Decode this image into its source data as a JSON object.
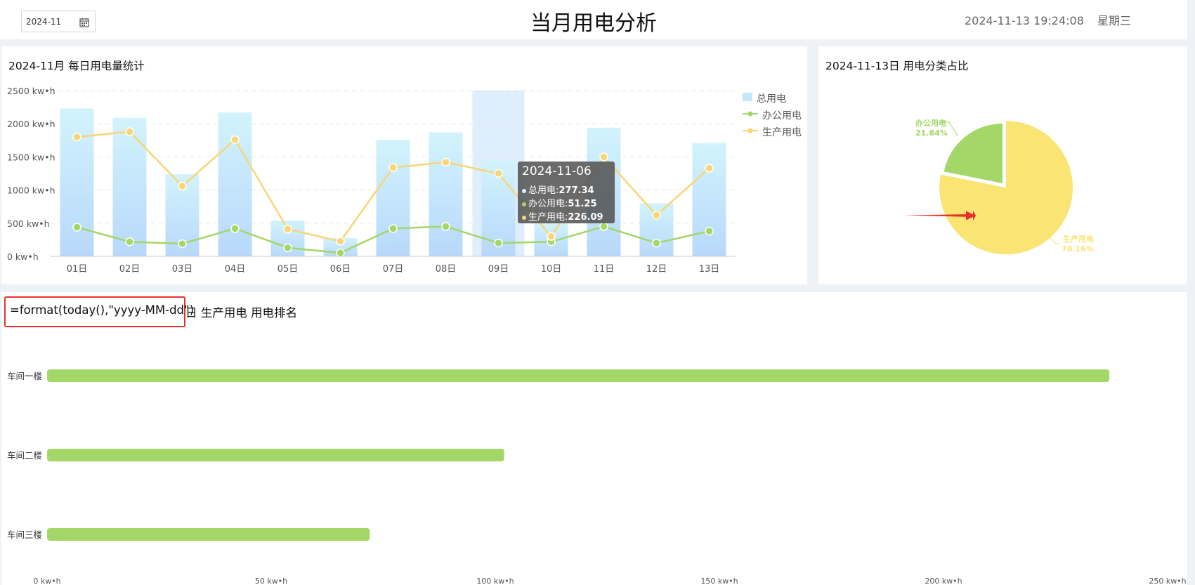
{
  "header": {
    "month_value": "2024-11",
    "title": "当月用电分析",
    "datetime": "2024-11-13 19:24:08",
    "weekday": "星期三"
  },
  "daily_panel": {
    "title": "2024-11月 每日用电量统计",
    "legend": [
      "总用电",
      "办公用电",
      "生产用电"
    ]
  },
  "tooltip": {
    "date": "2024-11-06",
    "rows": [
      {
        "label": "总用电:",
        "value": "277.34"
      },
      {
        "label": "办公用电:",
        "value": "51.25"
      },
      {
        "label": "生产用电:",
        "value": "226.09"
      }
    ]
  },
  "pie_panel": {
    "title": "2024-11-13日 用电分类占比"
  },
  "rank_panel": {
    "formula": "=format(today(),\"yyyy-MM-dd\")",
    "title_suffix": "日 生产用电 用电排名"
  },
  "colors": {
    "total_bar_top": "#d2f3fc",
    "total_bar_bottom": "#b8d8fb",
    "office": "#a3d768",
    "production": "#f8d677",
    "pie_production": "#fae574",
    "pie_office": "#a3d768",
    "highlight": "#e8302a"
  },
  "chart_data": [
    {
      "type": "bar",
      "title": "2024-11月 每日用电量统计",
      "categories": [
        "01日",
        "02日",
        "03日",
        "04日",
        "05日",
        "06日",
        "07日",
        "08日",
        "09日",
        "10日",
        "11日",
        "12日",
        "13日"
      ],
      "y_unit": "kw•h",
      "y_ticks": [
        0,
        500,
        1000,
        1500,
        2000,
        2500
      ],
      "ylim": [
        0,
        2500
      ],
      "grid": true,
      "legend_position": "right",
      "highlighted_category": "09日",
      "series": [
        {
          "name": "总用电",
          "kind": "bar",
          "values": [
            2230,
            2090,
            1240,
            2170,
            540,
            277.34,
            1760,
            1870,
            1450,
            520,
            1940,
            800,
            1710
          ]
        },
        {
          "name": "办公用电",
          "kind": "line",
          "values": [
            440,
            220,
            190,
            420,
            130,
            51.25,
            420,
            450,
            200,
            220,
            450,
            200,
            380
          ]
        },
        {
          "name": "生产用电",
          "kind": "line",
          "values": [
            1800,
            1880,
            1060,
            1760,
            410,
            226.09,
            1340,
            1420,
            1250,
            300,
            1500,
            620,
            1330
          ]
        }
      ]
    },
    {
      "type": "pie",
      "title": "2024-11-13日 用电分类占比",
      "slices": [
        {
          "name": "办公用电",
          "percent": 21.84,
          "label": "21.84%"
        },
        {
          "name": "生产用电",
          "percent": 78.16,
          "label": "78.16%"
        }
      ]
    },
    {
      "type": "bar",
      "orientation": "horizontal",
      "categories": [
        "车间一楼",
        "车间二楼",
        "车间三楼"
      ],
      "values": [
        237,
        102,
        72
      ],
      "x_ticks": [
        0,
        50,
        100,
        150,
        200,
        250
      ],
      "x_tick_labels": [
        "0 kw•h",
        "50 kw•h",
        "100 kw•h",
        "150 kw•h",
        "200 kw•h",
        "250 kw•h"
      ],
      "xlim": [
        0,
        250
      ]
    }
  ]
}
